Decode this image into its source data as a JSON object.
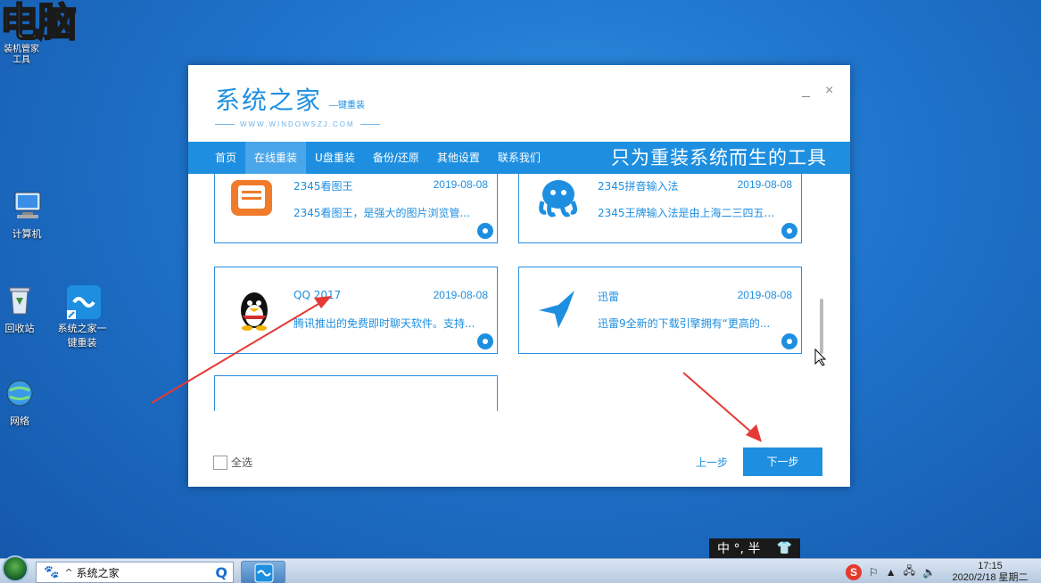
{
  "desktop": {
    "watermark": "电脑",
    "tool_label": "装机管家工具",
    "icons": [
      {
        "label": "计算机"
      },
      {
        "label": "回收站"
      },
      {
        "label": "系统之家一键重装"
      },
      {
        "label": "网络"
      }
    ]
  },
  "window": {
    "logo_title": "系统之家",
    "logo_sub": "—键重装",
    "logo_url": "WWW.WINDOWSZJ.COM",
    "minimize_label": "_",
    "close_label": "×",
    "nav": {
      "items": [
        {
          "label": "首页"
        },
        {
          "label": "在线重装"
        },
        {
          "label": "U盘重装"
        },
        {
          "label": "备份/还原"
        },
        {
          "label": "其他设置"
        },
        {
          "label": "联系我们"
        }
      ],
      "active_index": 1,
      "slogan": "只为重装系统而生的工具"
    },
    "software_cards": [
      {
        "name": "2345看图王",
        "date": "2019-08-08",
        "desc": "2345看图王，是强大的图片浏览管...",
        "icon": "image-viewer-icon",
        "checked": true
      },
      {
        "name": "2345拼音输入法",
        "date": "2019-08-08",
        "desc": "2345王牌输入法是由上海二三四五...",
        "icon": "octopus-icon",
        "checked": true
      },
      {
        "name": "QQ 2017",
        "date": "2019-08-08",
        "desc": "腾讯推出的免费即时聊天软件。支持...",
        "icon": "qq-penguin-icon",
        "checked": true
      },
      {
        "name": "迅雷",
        "date": "2019-08-08",
        "desc": "迅雷9全新的下载引擎拥有“更高的...",
        "icon": "thunder-bird-icon",
        "checked": true
      }
    ],
    "select_all_label": "全选",
    "prev_label": "上一步",
    "next_label": "下一步"
  },
  "ime": {
    "text": "中 °, 半"
  },
  "taskbar": {
    "search_text": "系统之家",
    "clock_time": "17:15",
    "clock_date": "2020/2/18 星期二"
  },
  "colors": {
    "accent": "#1e8fe0",
    "arrow": "#e53935",
    "desktop": "#1f74cc"
  }
}
